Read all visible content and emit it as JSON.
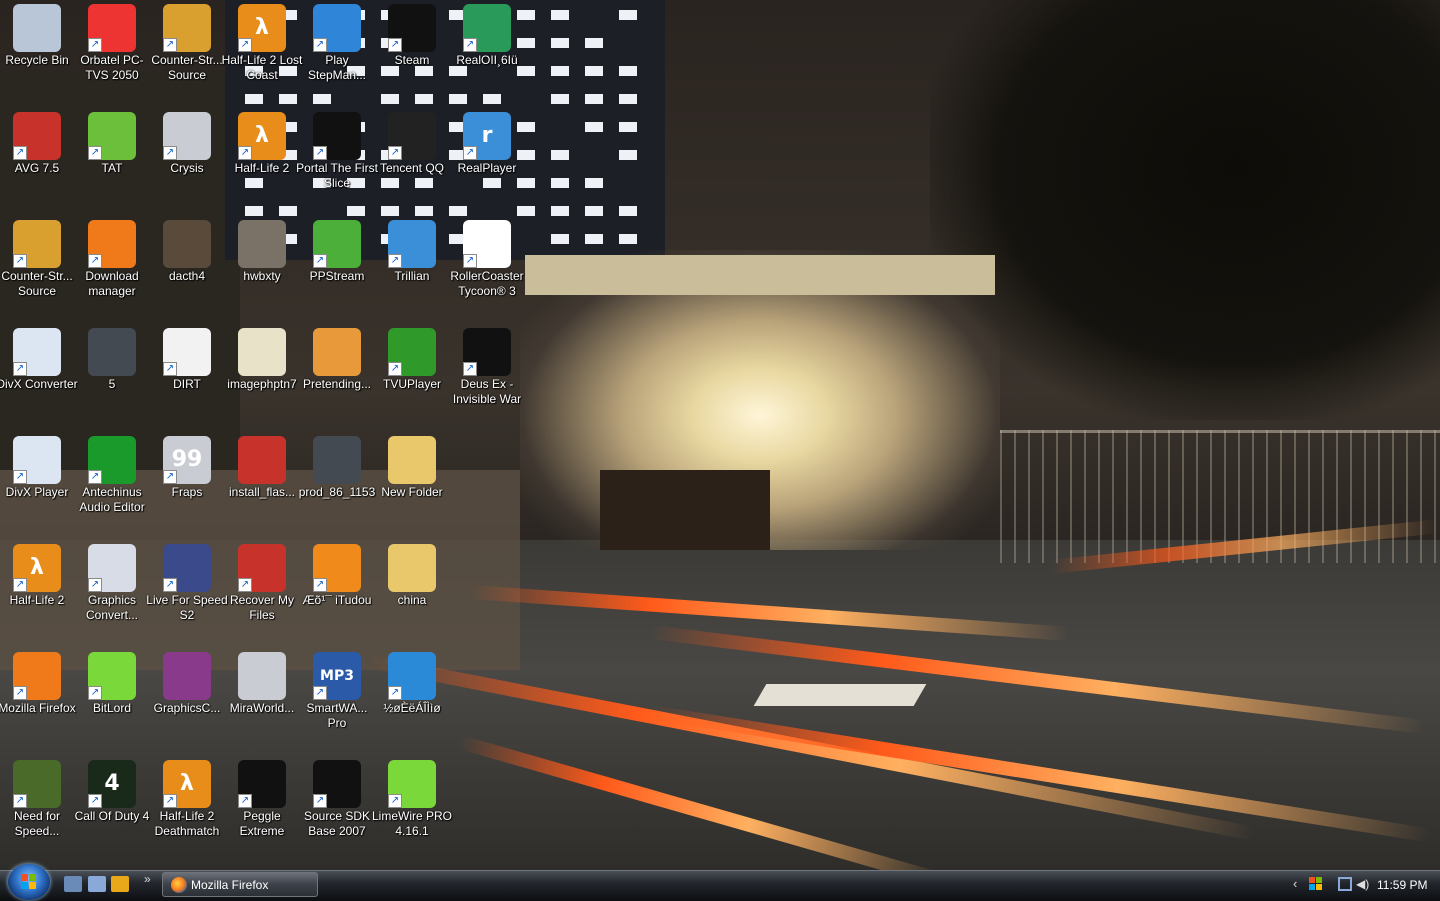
{
  "desktop": {
    "icons": [
      {
        "label": "Recycle Bin",
        "icon": "recycle-bin-icon",
        "color": "#b8c6d8",
        "glyph": "",
        "shortcut": false
      },
      {
        "label": "Orbatel PC-TVS 2050",
        "icon": "orbatel-icon",
        "color": "#e33",
        "glyph": "",
        "shortcut": true
      },
      {
        "label": "Counter-Str... Source",
        "icon": "counter-strike-icon",
        "color": "#d9a030",
        "glyph": "",
        "shortcut": true
      },
      {
        "label": "Half-Life 2 Lost Coast",
        "icon": "half-life-icon",
        "color": "#e88c1a",
        "glyph": "λ",
        "shortcut": true
      },
      {
        "label": "Play StepMan...",
        "icon": "stepmania-icon",
        "color": "#2f86d8",
        "glyph": "",
        "shortcut": true
      },
      {
        "label": "Steam",
        "icon": "steam-icon",
        "color": "#111111",
        "glyph": "",
        "shortcut": true
      },
      {
        "label": "RealOII¸6Iü",
        "icon": "realonline-icon",
        "color": "#2a9a5a",
        "glyph": "",
        "shortcut": true
      },
      {
        "label": "AVG 7.5",
        "icon": "avg-icon",
        "color": "#c7322a",
        "glyph": "",
        "shortcut": true
      },
      {
        "label": "TAT",
        "icon": "tat-icon",
        "color": "#6bbf3a",
        "glyph": "",
        "shortcut": true
      },
      {
        "label": "Crysis",
        "icon": "crysis-icon",
        "color": "#c9ccd2",
        "glyph": "",
        "shortcut": true
      },
      {
        "label": "Half-Life 2",
        "icon": "half-life-icon",
        "color": "#e88c1a",
        "glyph": "λ",
        "shortcut": true
      },
      {
        "label": "Portal The First Slice",
        "icon": "steam-icon",
        "color": "#111111",
        "glyph": "",
        "shortcut": true
      },
      {
        "label": "Tencent QQ",
        "icon": "qq-penguin-icon",
        "color": "#222222",
        "glyph": "",
        "shortcut": true
      },
      {
        "label": "RealPlayer",
        "icon": "realplayer-icon",
        "color": "#3b8fd8",
        "glyph": "r",
        "shortcut": true
      },
      {
        "label": "Counter-Str... Source",
        "icon": "counter-strike-icon",
        "color": "#d9a030",
        "glyph": "",
        "shortcut": true
      },
      {
        "label": "Download manager",
        "icon": "download-manager-icon",
        "color": "#f07a1a",
        "glyph": "",
        "shortcut": true
      },
      {
        "label": "dacth4",
        "icon": "image-file-icon",
        "color": "#5a4a3a",
        "glyph": "",
        "shortcut": false
      },
      {
        "label": "hwbxty",
        "icon": "image-file-icon",
        "color": "#7a7266",
        "glyph": "",
        "shortcut": false
      },
      {
        "label": "PPStream",
        "icon": "ppstream-icon",
        "color": "#4caf3a",
        "glyph": "",
        "shortcut": true
      },
      {
        "label": "Trillian",
        "icon": "trillian-icon",
        "color": "#3a8fd8",
        "glyph": "",
        "shortcut": true
      },
      {
        "label": "RollerCoaster Tycoon® 3",
        "icon": "rollercoaster-icon",
        "color": "#ffffff",
        "glyph": "",
        "shortcut": true
      },
      {
        "label": "DivX Converter",
        "icon": "divx-converter-icon",
        "color": "#dce6f2",
        "glyph": "",
        "shortcut": true
      },
      {
        "label": "5",
        "icon": "video-file-icon",
        "color": "#444a52",
        "glyph": "",
        "shortcut": false
      },
      {
        "label": "DIRT",
        "icon": "document-icon",
        "color": "#f2f2f2",
        "glyph": "",
        "shortcut": true
      },
      {
        "label": "imagephptn7",
        "icon": "image-file-icon",
        "color": "#e8e2c8",
        "glyph": "",
        "shortcut": false
      },
      {
        "label": "Pretending...",
        "icon": "image-file-icon",
        "color": "#e89a3a",
        "glyph": "",
        "shortcut": false
      },
      {
        "label": "TVUPlayer",
        "icon": "tvuplayer-icon",
        "color": "#2f9a2a",
        "glyph": "",
        "shortcut": true
      },
      {
        "label": "Deus Ex - Invisible War",
        "icon": "deus-ex-icon",
        "color": "#111111",
        "glyph": "",
        "shortcut": true
      },
      {
        "label": "DivX Player",
        "icon": "divx-player-icon",
        "color": "#dce6f2",
        "glyph": "",
        "shortcut": true
      },
      {
        "label": "Antechinus Audio Editor",
        "icon": "audio-editor-icon",
        "color": "#1a9a2a",
        "glyph": "",
        "shortcut": true
      },
      {
        "label": "Fraps",
        "icon": "fraps-icon",
        "color": "#c9ccd2",
        "glyph": "99",
        "shortcut": true
      },
      {
        "label": "install_flas...",
        "icon": "flash-installer-icon",
        "color": "#c7322a",
        "glyph": "",
        "shortcut": false
      },
      {
        "label": "prod_86_1153",
        "icon": "video-file-icon",
        "color": "#444a52",
        "glyph": "",
        "shortcut": false
      },
      {
        "label": "New Folder",
        "icon": "folder-icon",
        "color": "#e8c86a",
        "glyph": "",
        "shortcut": false
      },
      {
        "label": "Half-Life 2",
        "icon": "half-life-icon",
        "color": "#e88c1a",
        "glyph": "λ",
        "shortcut": true
      },
      {
        "label": "Graphics Convert...",
        "icon": "graphics-converter-icon",
        "color": "#d8dce6",
        "glyph": "",
        "shortcut": true
      },
      {
        "label": "Live For Speed S2",
        "icon": "live-for-speed-icon",
        "color": "#3a4a8a",
        "glyph": "",
        "shortcut": true
      },
      {
        "label": "Recover My Files",
        "icon": "recover-files-icon",
        "color": "#c7322a",
        "glyph": "",
        "shortcut": true
      },
      {
        "label": "Æõ¹¯ iTudou",
        "icon": "itudou-icon",
        "color": "#f08a1a",
        "glyph": "",
        "shortcut": true
      },
      {
        "label": "china",
        "icon": "folder-icon",
        "color": "#e8c86a",
        "glyph": "",
        "shortcut": false
      },
      {
        "label": "Mozilla Firefox",
        "icon": "firefox-icon",
        "color": "#f07a1a",
        "glyph": "",
        "shortcut": true
      },
      {
        "label": "BitLord",
        "icon": "bitlord-icon",
        "color": "#7ad83a",
        "glyph": "",
        "shortcut": true
      },
      {
        "label": "GraphicsC...",
        "icon": "winrar-archive-icon",
        "color": "#8a3a8a",
        "glyph": "",
        "shortcut": false
      },
      {
        "label": "MiraWorld...",
        "icon": "installer-icon",
        "color": "#c9ccd2",
        "glyph": "",
        "shortcut": false
      },
      {
        "label": "SmartWA... Pro",
        "icon": "mp3-converter-icon",
        "color": "#2a5aa8",
        "glyph": "MP3",
        "shortcut": true
      },
      {
        "label": "½øÈëÁÎÌìø",
        "icon": "globe-icon",
        "color": "#2a8ad8",
        "glyph": "",
        "shortcut": true
      },
      {
        "label": "Need for Speed...",
        "icon": "need-for-speed-icon",
        "color": "#4a6a2a",
        "glyph": "",
        "shortcut": true
      },
      {
        "label": "Call Of Duty 4",
        "icon": "call-of-duty-icon",
        "color": "#1a2a1a",
        "glyph": "4",
        "shortcut": true
      },
      {
        "label": "Half-Life 2 Deathmatch",
        "icon": "half-life-icon",
        "color": "#e88c1a",
        "glyph": "λ",
        "shortcut": true
      },
      {
        "label": "Peggle Extreme",
        "icon": "steam-icon",
        "color": "#111111",
        "glyph": "",
        "shortcut": true
      },
      {
        "label": "Source SDK Base 2007",
        "icon": "steam-icon",
        "color": "#111111",
        "glyph": "",
        "shortcut": true
      },
      {
        "label": "LimeWire PRO 4.16.1",
        "icon": "limewire-icon",
        "color": "#7ad83a",
        "glyph": "",
        "shortcut": true
      }
    ]
  },
  "taskbar": {
    "quicklaunch": [
      {
        "icon": "show-desktop-icon",
        "color": "#6a8ab8"
      },
      {
        "icon": "switch-windows-icon",
        "color": "#8aa8d8"
      },
      {
        "icon": "media-player-icon",
        "color": "#e8a81a"
      }
    ],
    "more_glyph": "»",
    "task": {
      "label": "Mozilla Firefox",
      "icon": "firefox-icon"
    },
    "tray_chevron": "‹",
    "tray_icons": [
      {
        "icon": "windows-flag-tray-icon",
        "color": "#4caf3a"
      },
      {
        "icon": "network-icon",
        "color": "#8aa8d8"
      },
      {
        "icon": "volume-icon",
        "color": "#dddddd"
      }
    ],
    "clock": "11:59 PM"
  }
}
